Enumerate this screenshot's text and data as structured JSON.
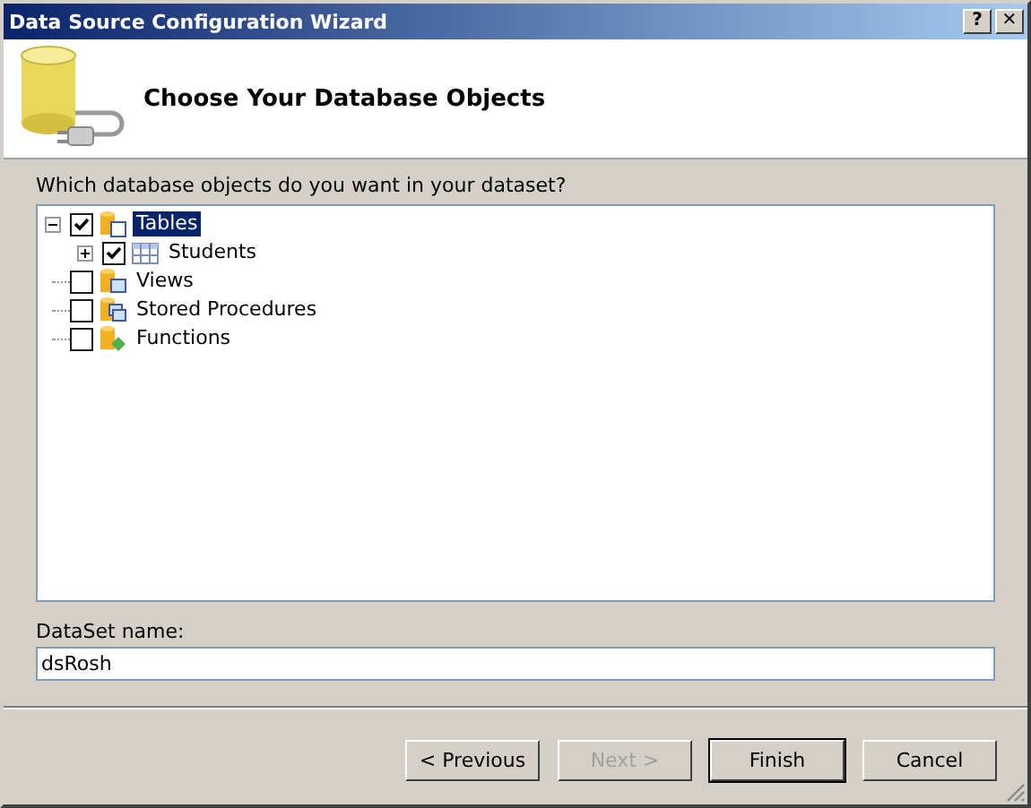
{
  "window": {
    "title": "Data Source Configuration Wizard",
    "help_button": "?",
    "close_button": "✕"
  },
  "header": {
    "title": "Choose Your Database Objects"
  },
  "prompt": "Which database objects do you want in your dataset?",
  "tree": [
    {
      "label": "Tables",
      "kind": "tables",
      "checked": true,
      "selected": true,
      "expanded": true,
      "children": [
        {
          "label": "Students",
          "kind": "table",
          "checked": true,
          "selected": false,
          "expanded": false
        }
      ]
    },
    {
      "label": "Views",
      "kind": "views",
      "checked": false,
      "selected": false
    },
    {
      "label": "Stored Procedures",
      "kind": "procedures",
      "checked": false,
      "selected": false
    },
    {
      "label": "Functions",
      "kind": "functions",
      "checked": false,
      "selected": false
    }
  ],
  "dataset": {
    "label": "DataSet name:",
    "value": "dsRosh"
  },
  "buttons": [
    {
      "label": "< Previous",
      "disabled": false,
      "default": false
    },
    {
      "label": "Next >",
      "disabled": true,
      "default": false
    },
    {
      "label": "Finish",
      "disabled": false,
      "default": true
    },
    {
      "label": "Cancel",
      "disabled": false,
      "default": false
    }
  ]
}
